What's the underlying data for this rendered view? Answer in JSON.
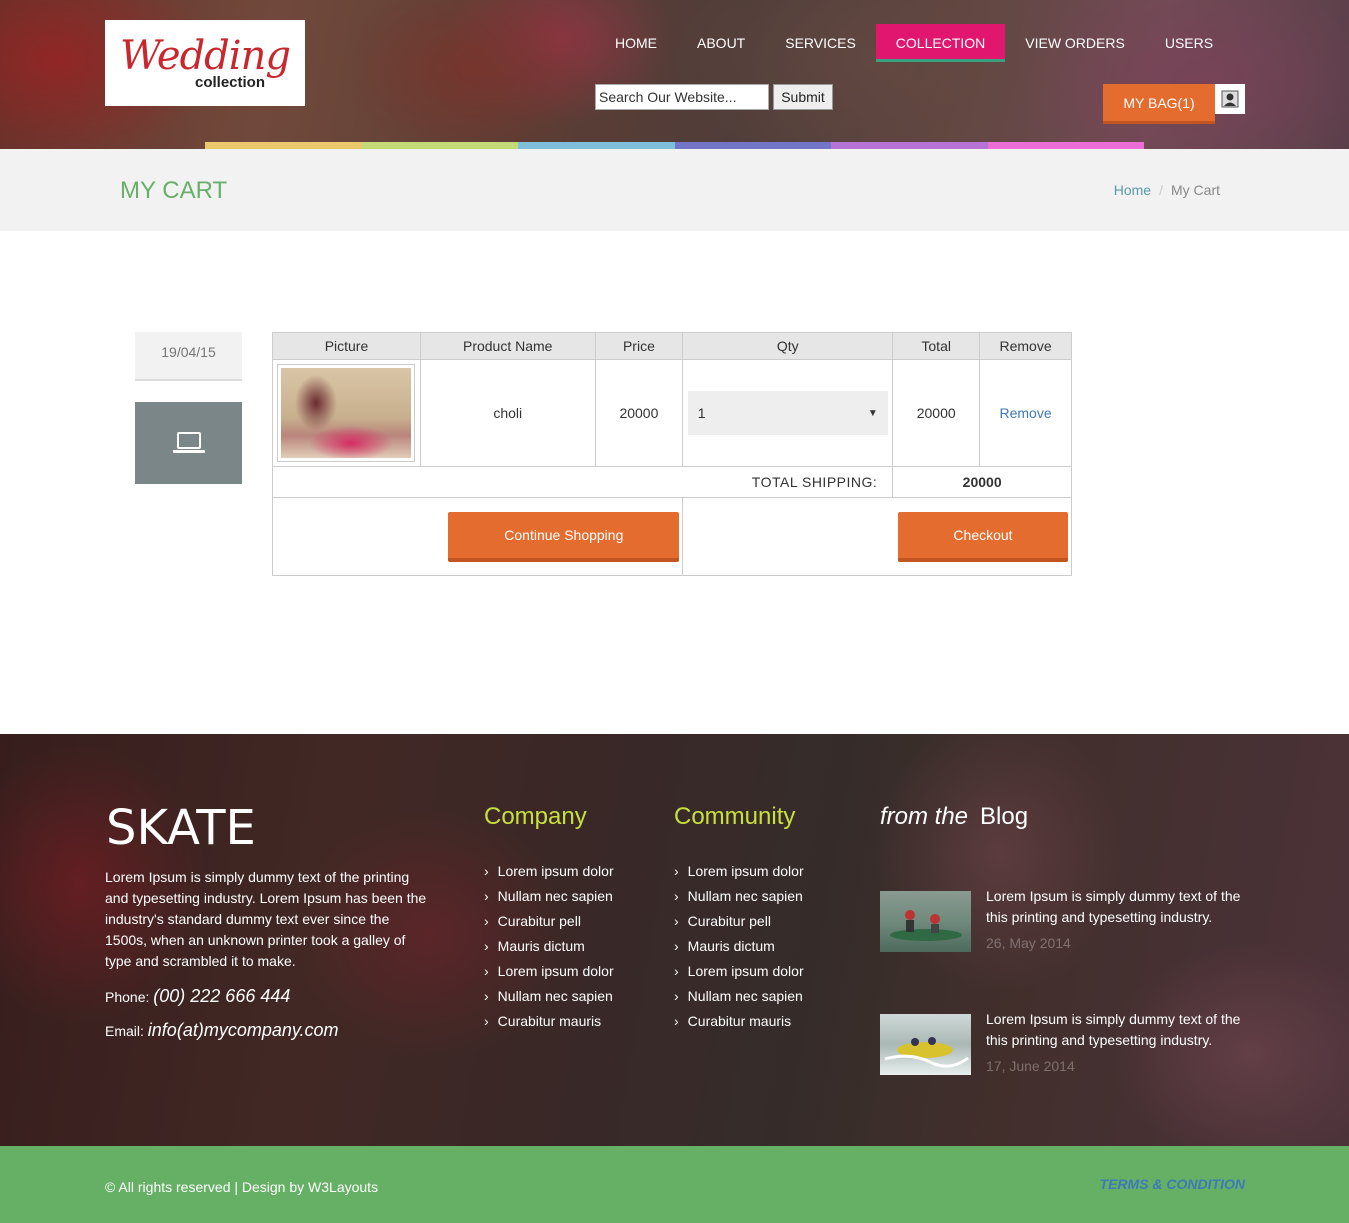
{
  "logo": {
    "script": "Wedding",
    "sub": "collection"
  },
  "nav": [
    {
      "label": "HOME"
    },
    {
      "label": "ABOUT"
    },
    {
      "label": "SERVICES"
    },
    {
      "label": "COLLECTION",
      "active": true
    },
    {
      "label": "VIEW ORDERS"
    },
    {
      "label": "USERS"
    }
  ],
  "search": {
    "placeholder": "Search Our Website...",
    "value": "Search Our Website...",
    "submit": "Submit"
  },
  "bag": {
    "label": "MY BAG(1)"
  },
  "rainbow_colors": [
    "#e9c96b",
    "#c3da77",
    "#7ec0d9",
    "#7375c9",
    "#b573d6",
    "#ec6fd8"
  ],
  "page": {
    "title": "MY CART"
  },
  "breadcrumb": {
    "home": "Home",
    "current": "My Cart"
  },
  "cart": {
    "date": "19/04/15",
    "headers": [
      "Picture",
      "Product Name",
      "Price",
      "Qty",
      "Total",
      "Remove"
    ],
    "items": [
      {
        "name": "choli",
        "price": "20000",
        "qty": "1",
        "total": "20000",
        "remove": "Remove"
      }
    ],
    "shipping_label": "TOTAL SHIPPING:",
    "shipping_total": "20000",
    "continue": "Continue Shopping",
    "checkout": "Checkout"
  },
  "footer": {
    "brand": "SKATE",
    "about": "Lorem Ipsum is simply dummy text of the printing and typesetting industry. Lorem Ipsum has been the industry's standard dummy text ever since the 1500s, when an unknown printer took a galley of type and scrambled it to make.",
    "phone_label": "Phone:",
    "phone": "(00) 222 666 444",
    "email_label": "Email:",
    "email": "info(at)mycompany.com",
    "company": {
      "title": "Company",
      "links": [
        "Lorem ipsum dolor",
        "Nullam nec sapien",
        "Curabitur pell",
        "Mauris dictum",
        "Lorem ipsum dolor",
        "Nullam nec sapien",
        "Curabitur mauris"
      ]
    },
    "community": {
      "title": "Community",
      "links": [
        "Lorem ipsum dolor",
        "Nullam nec sapien",
        "Curabitur pell",
        "Mauris dictum",
        "Lorem ipsum dolor",
        "Nullam nec sapien",
        "Curabitur mauris"
      ]
    },
    "blog": {
      "title_prefix": "from the",
      "title": "Blog",
      "posts": [
        {
          "text": "Lorem Ipsum is simply dummy text of the this printing and typesetting industry.",
          "date": "26, May 2014"
        },
        {
          "text": "Lorem Ipsum is simply dummy text of the this printing and typesetting industry.",
          "date": "17, June 2014"
        }
      ]
    }
  },
  "bottom": {
    "copyright": "© All rights reserved | Design by W3Layouts",
    "terms": "TERMS & CONDITION"
  }
}
